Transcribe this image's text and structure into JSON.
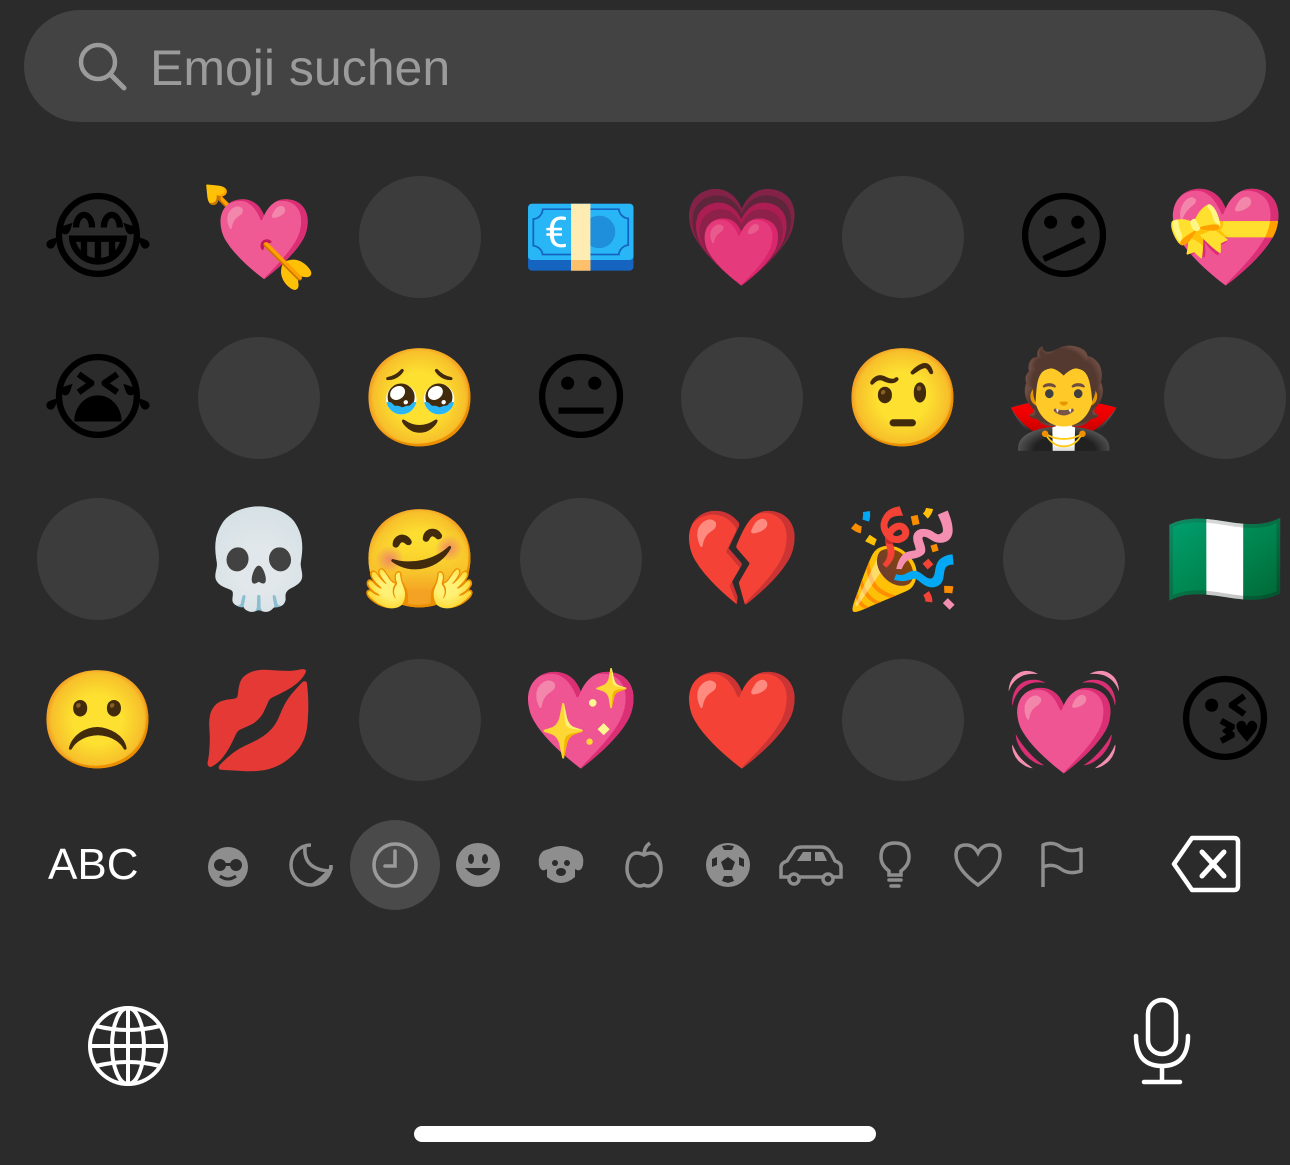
{
  "search": {
    "placeholder": "Emoji suchen",
    "icon": "search-icon"
  },
  "emoji_grid": {
    "rows": [
      [
        "😂",
        "💘",
        "",
        "💶",
        "💗",
        "",
        "😕",
        "💝"
      ],
      [
        "😭",
        "",
        "🥹",
        "😐",
        "",
        "🤨",
        "🧛",
        ""
      ],
      [
        "",
        "💀",
        "🤗",
        "",
        "💔",
        "🎉",
        "",
        "🇳🇬"
      ],
      [
        "☹️",
        "💋",
        "",
        "💖",
        "❤️",
        "",
        "💓",
        "😘"
      ]
    ]
  },
  "category_bar": {
    "abc_label": "ABC",
    "categories": [
      {
        "name": "memoji-stickers",
        "icon": "memoji-icon"
      },
      {
        "name": "stickers",
        "icon": "sticker-icon"
      },
      {
        "name": "recents",
        "icon": "clock-icon",
        "active": true
      },
      {
        "name": "smileys",
        "icon": "smiley-icon"
      },
      {
        "name": "animals",
        "icon": "dog-icon"
      },
      {
        "name": "food",
        "icon": "apple-icon"
      },
      {
        "name": "activity",
        "icon": "soccer-ball-icon"
      },
      {
        "name": "travel",
        "icon": "car-icon"
      },
      {
        "name": "objects",
        "icon": "lightbulb-icon"
      },
      {
        "name": "symbols",
        "icon": "heart-outline-icon"
      },
      {
        "name": "flags",
        "icon": "flag-icon"
      }
    ],
    "delete_icon": "backspace-icon"
  },
  "bottom_bar": {
    "globe_icon": "globe-icon",
    "mic_icon": "microphone-icon"
  },
  "colors": {
    "background": "#2b2b2b",
    "search_background": "#434343",
    "placeholder_text": "#9b9b9b",
    "placeholder_circle": "#3c3c3c",
    "icon_gray": "#8e8e8e",
    "active_category_bg": "#4a4a4a"
  }
}
